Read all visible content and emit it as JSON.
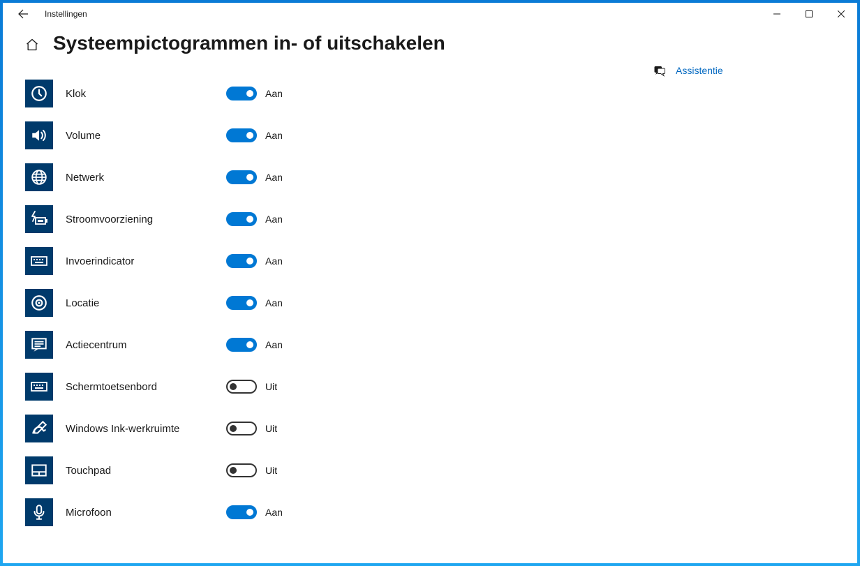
{
  "window": {
    "title": "Instellingen"
  },
  "page": {
    "title": "Systeempictogrammen in- of uitschakelen",
    "onLabel": "Aan",
    "offLabel": "Uit"
  },
  "items": [
    {
      "id": "clock",
      "label": "Klok",
      "on": true
    },
    {
      "id": "volume",
      "label": "Volume",
      "on": true
    },
    {
      "id": "network",
      "label": "Netwerk",
      "on": true
    },
    {
      "id": "power",
      "label": "Stroomvoorziening",
      "on": true
    },
    {
      "id": "input-indicator",
      "label": "Invoerindicator",
      "on": true
    },
    {
      "id": "location",
      "label": "Locatie",
      "on": true
    },
    {
      "id": "action-center",
      "label": "Actiecentrum",
      "on": true
    },
    {
      "id": "touch-keyboard",
      "label": "Schermtoetsenbord",
      "on": false
    },
    {
      "id": "windows-ink",
      "label": "Windows Ink-werkruimte",
      "on": false
    },
    {
      "id": "touchpad",
      "label": "Touchpad",
      "on": false
    },
    {
      "id": "microphone",
      "label": "Microfoon",
      "on": true
    }
  ],
  "side": {
    "assist": "Assistentie"
  }
}
